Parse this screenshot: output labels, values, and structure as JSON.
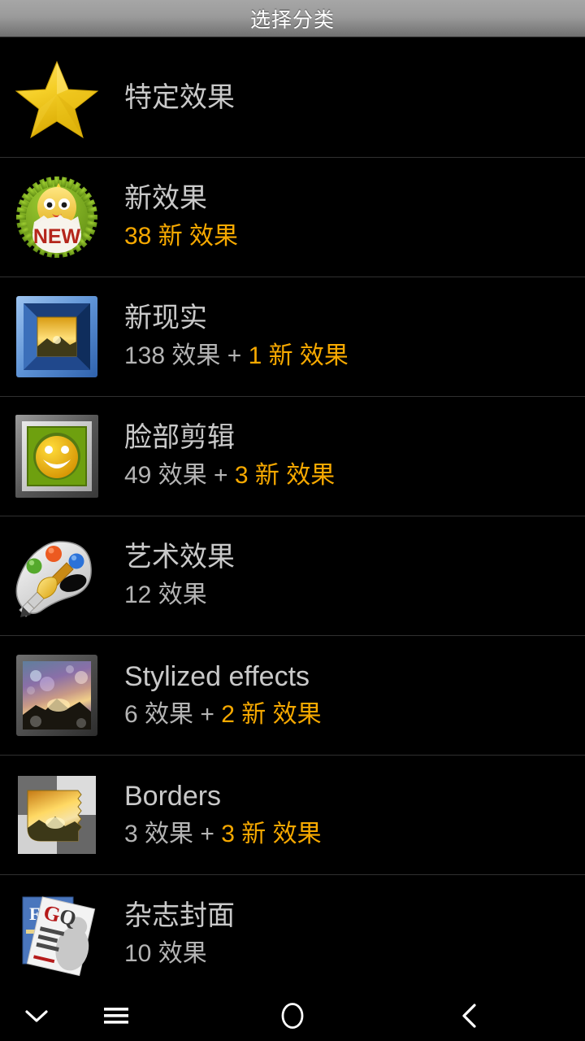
{
  "header": {
    "title": "选择分类"
  },
  "list": {
    "items": [
      {
        "icon": "gold-star-icon",
        "title": "特定效果",
        "sub_plain": "",
        "sub_gold": "",
        "has_sub": false
      },
      {
        "icon": "new-chick-badge-icon",
        "title": "新效果",
        "sub_plain": "",
        "sub_gold": "38 新 效果",
        "has_sub": true
      },
      {
        "icon": "blue-frame-photo-icon",
        "title": "新现实",
        "sub_plain": "138 效果 + ",
        "sub_gold": "1 新 效果",
        "has_sub": true
      },
      {
        "icon": "silver-frame-smiley-icon",
        "title": "脸部剪辑",
        "sub_plain": "49 效果 + ",
        "sub_gold": "3 新 效果",
        "has_sub": true
      },
      {
        "icon": "paint-palette-icon",
        "title": "艺术效果",
        "sub_plain": "12 效果",
        "sub_gold": "",
        "has_sub": true
      },
      {
        "icon": "bokeh-sunset-frame-icon",
        "title": "Stylized effects",
        "sub_plain": "6 效果 + ",
        "sub_gold": "2 新 效果",
        "has_sub": true
      },
      {
        "icon": "torn-border-photo-icon",
        "title": "Borders",
        "sub_plain": "3 效果 + ",
        "sub_gold": "3 新 效果",
        "has_sub": true
      },
      {
        "icon": "magazine-covers-icon",
        "title": "杂志封面",
        "sub_plain": "10 效果",
        "sub_gold": "",
        "has_sub": true
      }
    ]
  },
  "navbar": {
    "buttons": [
      {
        "name": "hide-keyboard-button",
        "icon": "chevron-down-icon"
      },
      {
        "name": "menu-button",
        "icon": "hamburger-menu-icon"
      },
      {
        "name": "home-button",
        "icon": "circle-home-icon"
      },
      {
        "name": "back-button",
        "icon": "chevron-left-icon"
      }
    ]
  },
  "colors": {
    "accent_gold": "#f7a900",
    "title_text": "#c9c9c9",
    "subtitle_text": "#b4b4b4",
    "background": "#000000",
    "titlebar_top": "#a6a6a6",
    "titlebar_bottom": "#6f6f6f",
    "divider": "#303030"
  }
}
